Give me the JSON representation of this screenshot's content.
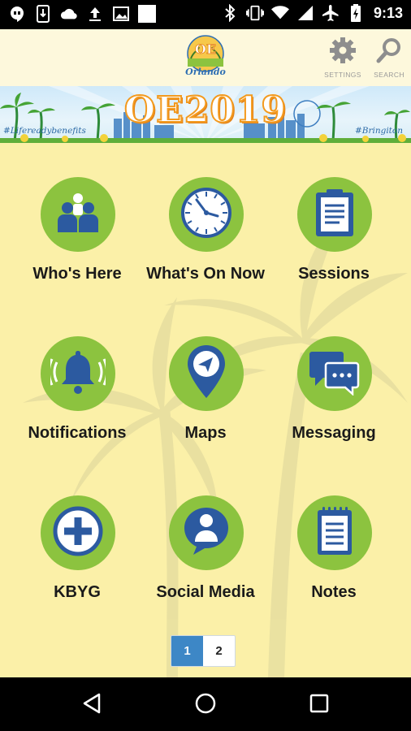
{
  "status_bar": {
    "time": "9:13",
    "left_icons": [
      "hangouts-icon",
      "phone-download-icon",
      "cloud-icon",
      "upload-icon",
      "image-icon",
      "blank-square-icon"
    ],
    "right_icons": [
      "bluetooth-icon",
      "vibrate-icon",
      "wifi-icon",
      "cellular-signal-icon",
      "airplane-icon",
      "battery-charging-icon"
    ]
  },
  "header": {
    "logo_text": "OE",
    "logo_subtext": "Orlando",
    "settings_label": "SETTINGS",
    "search_label": "SEARCH"
  },
  "banner": {
    "title": "OE2019",
    "tag_left": "#Lifereadybenefits",
    "tag_right": "#Bringiton"
  },
  "tiles": [
    {
      "label": "Who's Here",
      "icon": "people-icon"
    },
    {
      "label": "What's On Now",
      "icon": "clock-icon"
    },
    {
      "label": "Sessions",
      "icon": "clipboard-icon"
    },
    {
      "label": "Notifications",
      "icon": "bell-icon"
    },
    {
      "label": "Maps",
      "icon": "map-pin-icon"
    },
    {
      "label": "Messaging",
      "icon": "chat-icon"
    },
    {
      "label": "KBYG",
      "icon": "plus-icon"
    },
    {
      "label": "Social Media",
      "icon": "social-person-icon"
    },
    {
      "label": "Notes",
      "icon": "notepad-icon"
    }
  ],
  "pager": {
    "pages": [
      "1",
      "2"
    ],
    "current": "1"
  },
  "colors": {
    "background": "#fbf0a8",
    "tile_circle": "#8cc33f",
    "icon_blue": "#2c5aa0",
    "pager_active": "#3d87c6",
    "banner_orange": "#f39a1f"
  },
  "nav_bar": [
    "back-icon",
    "home-icon",
    "recents-icon"
  ]
}
